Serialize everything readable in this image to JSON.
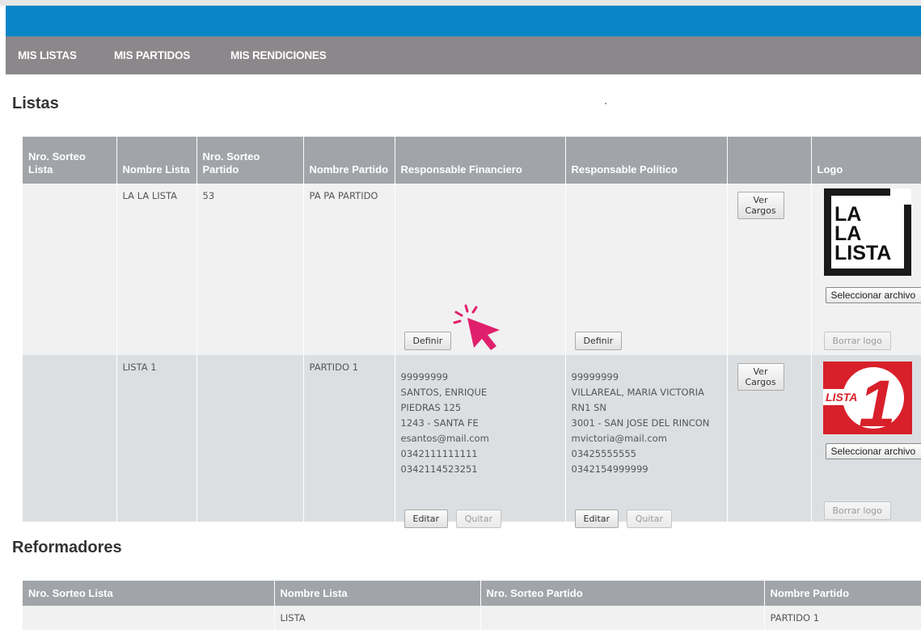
{
  "nav": {
    "items": [
      {
        "label": "MIS LISTAS"
      },
      {
        "label": "MIS PARTIDOS"
      },
      {
        "label": "MIS RENDICIONES"
      }
    ]
  },
  "listas": {
    "title": "Listas",
    "headers": {
      "nro_sorteo_lista": "Nro. Sorteo Lista",
      "nombre_lista": "Nombre Lista",
      "nro_sorteo_partido": "Nro. Sorteo Partido",
      "nombre_partido": "Nombre Partido",
      "resp_financiero": "Responsable Financiero",
      "resp_politico": "Responsable Político",
      "acciones": "",
      "logo": "Logo"
    },
    "rows": [
      {
        "nro_sorteo_lista": "",
        "nombre_lista": "LA LA LISTA",
        "nro_sorteo_partido": "53",
        "nombre_partido": "PA PA PARTIDO",
        "definir_label": "Definir",
        "ver_cargos_label": "Ver Cargos",
        "logo_text": [
          "LA",
          "LA",
          "LISTA"
        ],
        "file_label": "Seleccionar archivo",
        "borrar_logo_label": "Borrar logo"
      },
      {
        "nro_sorteo_lista": "",
        "nombre_lista": "LISTA 1",
        "nro_sorteo_partido": "",
        "nombre_partido": "PARTIDO 1",
        "financiero": {
          "dni": "99999999",
          "nombre": "SANTOS, ENRIQUE",
          "direccion": "PIEDRAS 125",
          "localidad": "1243 - SANTA FE",
          "email": "esantos@mail.com",
          "tel1": "0342111111111",
          "tel2": "0342114523251"
        },
        "politico": {
          "dni": "99999999",
          "nombre": "VILLAREAL, MARIA VICTORIA",
          "direccion": "RN1 SN",
          "localidad": "3001 - SAN JOSE DEL RINCON",
          "email": "mvictoria@mail.com",
          "tel1": "03425555555",
          "tel2": "0342154999999"
        },
        "editar_label": "Editar",
        "quitar_label": "Quitar",
        "ver_cargos_label": "Ver Cargos",
        "logo_text": [
          "LISTA",
          "1"
        ],
        "file_label": "Seleccionar archivo",
        "borrar_logo_label": "Borrar logo"
      }
    ]
  },
  "reformadores": {
    "title": "Reformadores",
    "headers": {
      "nro_sorteo_lista": "Nro. Sorteo Lista",
      "nombre_lista": "Nombre Lista",
      "nro_sorteo_partido": "Nro. Sorteo Partido",
      "nombre_partido": "Nombre Partido"
    },
    "rows": [
      {
        "nro_sorteo_lista": "",
        "nombre_lista": "LISTA",
        "nro_sorteo_partido": "",
        "nombre_partido": "PARTIDO 1"
      }
    ]
  },
  "colors": {
    "blue_bar": "#0a86c6",
    "nav_bg": "#8b878a",
    "header_bg": "#a1a4a8",
    "cursor_accent": "#e0206c"
  },
  "icons": {
    "cursor": "click-pointer-icon"
  }
}
